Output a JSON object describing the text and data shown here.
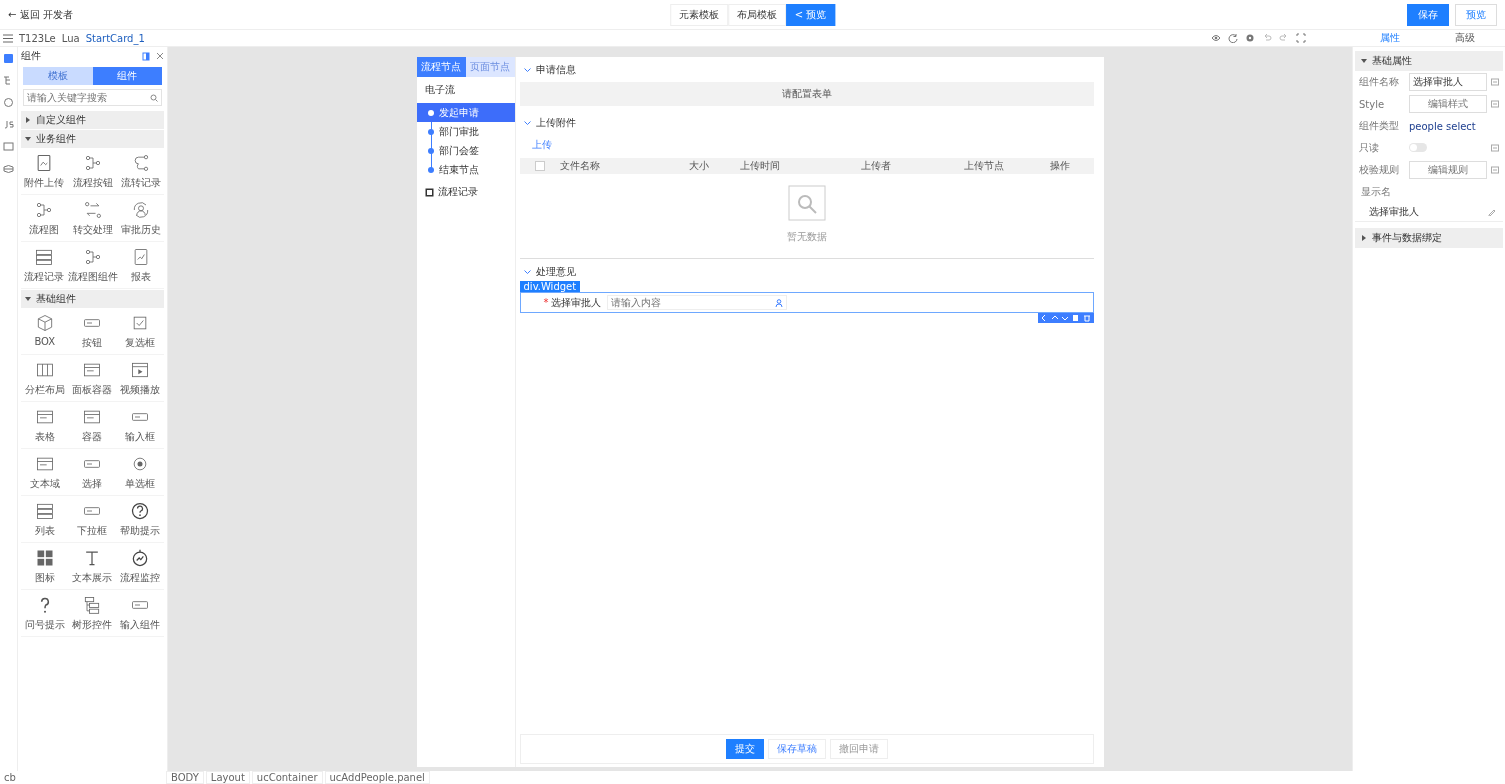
{
  "header": {
    "back": "← 返回 开发者",
    "mode_tabs": [
      {
        "label": "元素模板",
        "selected": false
      },
      {
        "label": "布局模板",
        "selected": false
      },
      {
        "label": "< 预览",
        "selected": true
      }
    ],
    "buttons": [
      {
        "label": "保存",
        "kind": "primary"
      },
      {
        "label": "预览",
        "kind": "plain"
      }
    ]
  },
  "breadcrumb": {
    "items": [
      "T123Le",
      "Lua",
      "StartCard_1"
    ]
  },
  "prop_tabs": [
    {
      "label": "属性",
      "selected": true
    },
    {
      "label": "高级",
      "selected": false
    }
  ],
  "left_panel": {
    "title": "组件",
    "tabs": [
      {
        "label": "模板",
        "selected": false
      },
      {
        "label": "组件",
        "selected": true
      }
    ],
    "search": {
      "placeholder": "请输入关键字搜索"
    },
    "groups": [
      {
        "title": "自定义组件",
        "expanded": false
      },
      {
        "title": "业务组件",
        "expanded": true,
        "items": [
          "附件上传",
          "流程按钮",
          "流转记录",
          "流程图",
          "转交处理",
          "审批历史",
          "流程记录",
          "流程图组件",
          "报表"
        ]
      },
      {
        "title": "基础组件",
        "expanded": true,
        "items": [
          "BOX",
          "按钮",
          "复选框",
          "分栏布局",
          "面板容器",
          "视频播放",
          "表格",
          "容器",
          "输入框",
          "文本域",
          "选择",
          "单选框",
          "列表",
          "下拉框",
          "帮助提示",
          "图标",
          "文本展示",
          "流程监控",
          "问号提示",
          "树形控件",
          "输入组件"
        ]
      }
    ]
  },
  "canvas": {
    "nav_tabs": [
      {
        "label": "流程节点",
        "selected": true
      },
      {
        "label": "页面节点",
        "selected": false
      }
    ],
    "nav_title": "电子流",
    "steps": [
      {
        "label": "发起申请",
        "selected": true
      },
      {
        "label": "部门审批",
        "selected": false
      },
      {
        "label": "部门会签",
        "selected": false
      },
      {
        "label": "结束节点",
        "selected": false
      }
    ],
    "nav_extra": "流程记录",
    "sections": [
      {
        "title": "申请信息",
        "kind": "form",
        "placeholder": "请配置表单"
      },
      {
        "title": "上传附件",
        "kind": "table",
        "link": "上传",
        "select_all_checked": false,
        "columns": [
          "文件名称",
          "大小",
          "上传时间",
          "上传者",
          "上传节点",
          "操作"
        ],
        "empty": "暂无数据"
      },
      {
        "title": "处理意见",
        "kind": "field",
        "tag": "div.Widget",
        "label": "选择审批人",
        "required_mark": "*",
        "field_placeholder": "请输入内容"
      }
    ],
    "footer_buttons": [
      {
        "label": "提交",
        "kind": "primary"
      },
      {
        "label": "保存草稿",
        "kind": "plain"
      },
      {
        "label": "撤回申请",
        "kind": "disabled"
      }
    ]
  },
  "right_panel": {
    "section": "基础属性",
    "rows": [
      {
        "label": "组件名称",
        "kind": "input",
        "value": "选择审批人"
      },
      {
        "label": "Style",
        "kind": "button",
        "value": "编辑样式"
      },
      {
        "label": "组件类型",
        "kind": "text",
        "value": "people select"
      },
      {
        "label": "只读",
        "kind": "toggle",
        "on": false
      },
      {
        "label": "校验规则",
        "kind": "button",
        "value": "编辑规则"
      }
    ],
    "display_label": "显示名",
    "display_value": "选择审批人",
    "collapsed_section": "事件与数据绑定"
  },
  "status_bar": {
    "left": "cb",
    "path": [
      "BODY",
      "Layout",
      "ucContainer",
      "ucAddPeople.panel"
    ]
  }
}
